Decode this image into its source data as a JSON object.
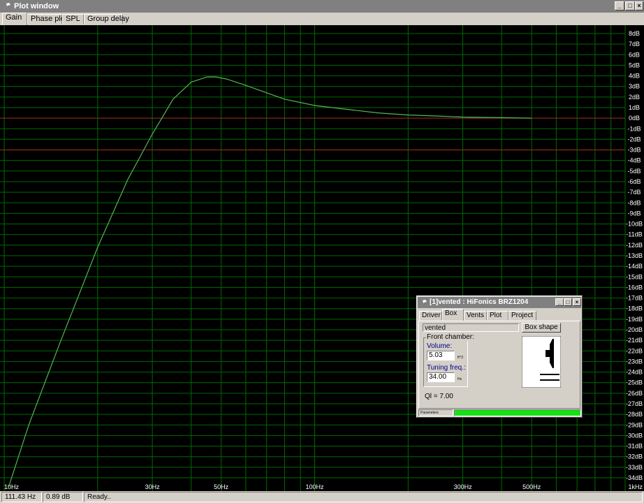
{
  "window": {
    "title": "Plot window",
    "tabs": [
      "Gain",
      "Phase plot",
      "SPL",
      "Group delay"
    ],
    "active_tab": "Gain"
  },
  "colors": {
    "background": "#000000",
    "grid": "#006a00",
    "curve": "#52b852",
    "reference_line": "#a02020",
    "progress": "#18e018"
  },
  "chart_data": {
    "type": "line",
    "xscale": "log",
    "xlim": [
      10,
      1000
    ],
    "ylim": [
      -35,
      9
    ],
    "x_tick_labels": [
      "10Hz",
      "30Hz",
      "50Hz",
      "100Hz",
      "300Hz",
      "500Hz",
      "1kHz"
    ],
    "x_tick_values": [
      10,
      30,
      50,
      100,
      300,
      500,
      1000
    ],
    "y_tick_labels": [
      "8dB",
      "7dB",
      "6dB",
      "5dB",
      "4dB",
      "3dB",
      "2dB",
      "1dB",
      "0dB",
      "-1dB",
      "-2dB",
      "-3dB",
      "-4dB",
      "-5dB",
      "-6dB",
      "-7dB",
      "-8dB",
      "-9dB",
      "-10dB",
      "-11dB",
      "-12dB",
      "-13dB",
      "-14dB",
      "-15dB",
      "-16dB",
      "-17dB",
      "-18dB",
      "-19dB",
      "-20dB",
      "-21dB",
      "-22dB",
      "-23dB",
      "-24dB",
      "-25dB",
      "-26dB",
      "-27dB",
      "-28dB",
      "-29dB",
      "-30dB",
      "-31dB",
      "-32dB",
      "-33dB",
      "-34dB"
    ],
    "y_tick_values": [
      8,
      7,
      6,
      5,
      4,
      3,
      2,
      1,
      0,
      -1,
      -2,
      -3,
      -4,
      -5,
      -6,
      -7,
      -8,
      -9,
      -10,
      -11,
      -12,
      -13,
      -14,
      -15,
      -16,
      -17,
      -18,
      -19,
      -20,
      -21,
      -22,
      -23,
      -24,
      -25,
      -26,
      -27,
      -28,
      -29,
      -30,
      -31,
      -32,
      -33,
      -34
    ],
    "reference_lines": [
      0,
      -3
    ],
    "grid": true,
    "series": [
      {
        "x": [
          10.3,
          12,
          15,
          20,
          25,
          30,
          35,
          40,
          45,
          48,
          52,
          60,
          70,
          80,
          100,
          130,
          160,
          200,
          250,
          300,
          400,
          500
        ],
        "y": [
          -35,
          -29,
          -21.5,
          -12.2,
          -5.8,
          -1.5,
          1.8,
          3.4,
          3.9,
          3.9,
          3.7,
          3.1,
          2.4,
          1.8,
          1.2,
          0.8,
          0.5,
          0.3,
          0.2,
          0.1,
          0.05,
          0.0
        ]
      }
    ]
  },
  "status": {
    "freq": "111.43 Hz",
    "gain": "0.89 dB",
    "message": "Ready.."
  },
  "dialog": {
    "title": "[1]vented : HiFonics BRZ1204",
    "tabs": [
      "Driver",
      "Box",
      "Vents",
      "Plot",
      "Project"
    ],
    "active_tab": "Box",
    "box_type": "vented",
    "box_shape_button": "Box shape",
    "group_label": "Front chamber:",
    "volume_label": "Volume:",
    "volume_value": "5.03",
    "volume_unit": "ft^3",
    "tuning_label": "Tuning freq.:",
    "tuning_value": "34.00",
    "tuning_unit": "Hz",
    "ql": "Ql = 7.00",
    "status_label": "Parameters",
    "progress": 1.0
  }
}
